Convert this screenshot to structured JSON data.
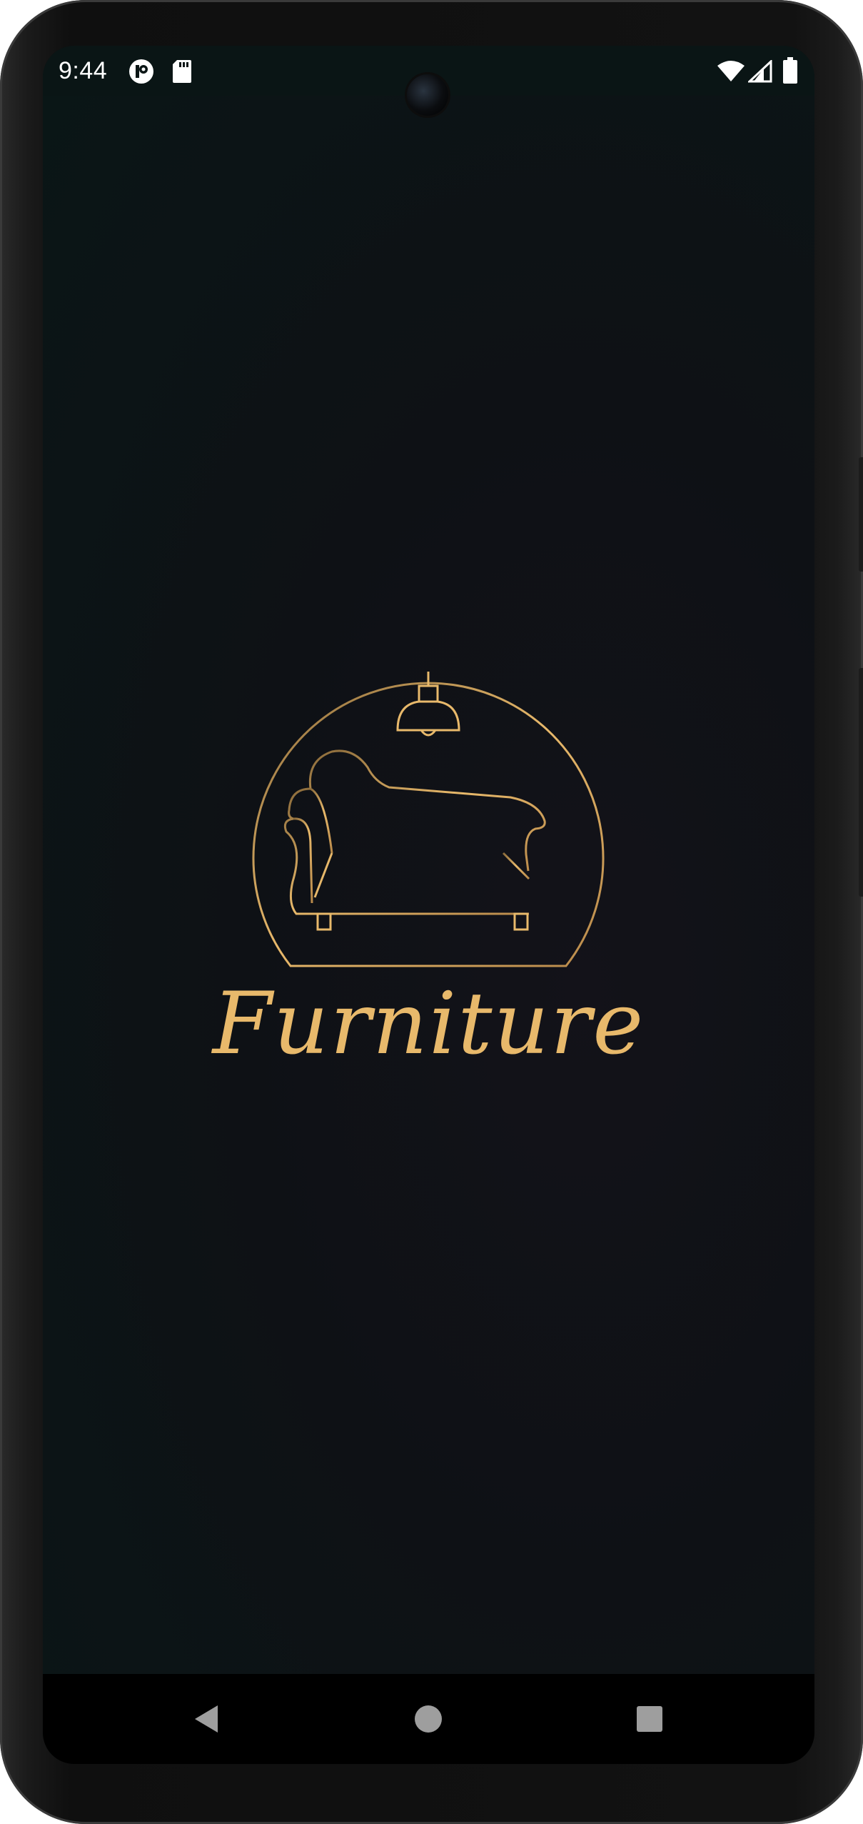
{
  "status_bar": {
    "time": "9:44",
    "icons": [
      "app-notification-icon",
      "sd-card-icon",
      "wifi-icon",
      "cell-signal-icon",
      "battery-icon"
    ]
  },
  "splash": {
    "brand_text": "Furniture",
    "logo_icon": "sofa-lamp-logo",
    "accent_color": "#e8b96b"
  },
  "navigation": {
    "back_icon": "back-icon",
    "home_icon": "home-icon",
    "recents_icon": "recents-icon"
  }
}
